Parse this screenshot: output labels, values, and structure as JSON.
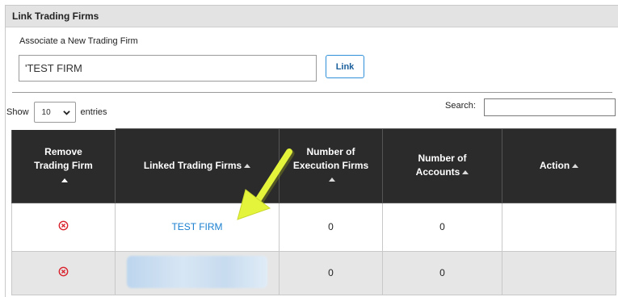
{
  "panel": {
    "title": "Link Trading Firms"
  },
  "associate": {
    "label": "Associate a New Trading Firm",
    "input_value": "'TEST FIRM",
    "link_button": "Link"
  },
  "length": {
    "show": "Show",
    "value": "10",
    "entries": "entries"
  },
  "search": {
    "label": "Search:"
  },
  "table": {
    "headers": {
      "remove_line1": "Remove",
      "remove_line2": "Trading Firm",
      "linked": "Linked Trading Firms",
      "exec_line1": "Number of",
      "exec_line2": "Execution Firms",
      "acct_line1": "Number of",
      "acct_line2": "Accounts",
      "action": "Action"
    },
    "rows": [
      {
        "firm": "TEST FIRM",
        "execution_firms": "0",
        "accounts": "0",
        "action": ""
      },
      {
        "firm": "",
        "execution_firms": "0",
        "accounts": "0",
        "action": ""
      }
    ]
  },
  "colors": {
    "header_bg": "#2b2b2b",
    "link": "#1a7fd0",
    "remove": "#d9232d",
    "annotation_arrow": "#e4f43a"
  },
  "icons": {
    "remove": "remove-circle-icon",
    "chevron": "chevron-down-icon",
    "sort": "sort-asc-icon"
  }
}
